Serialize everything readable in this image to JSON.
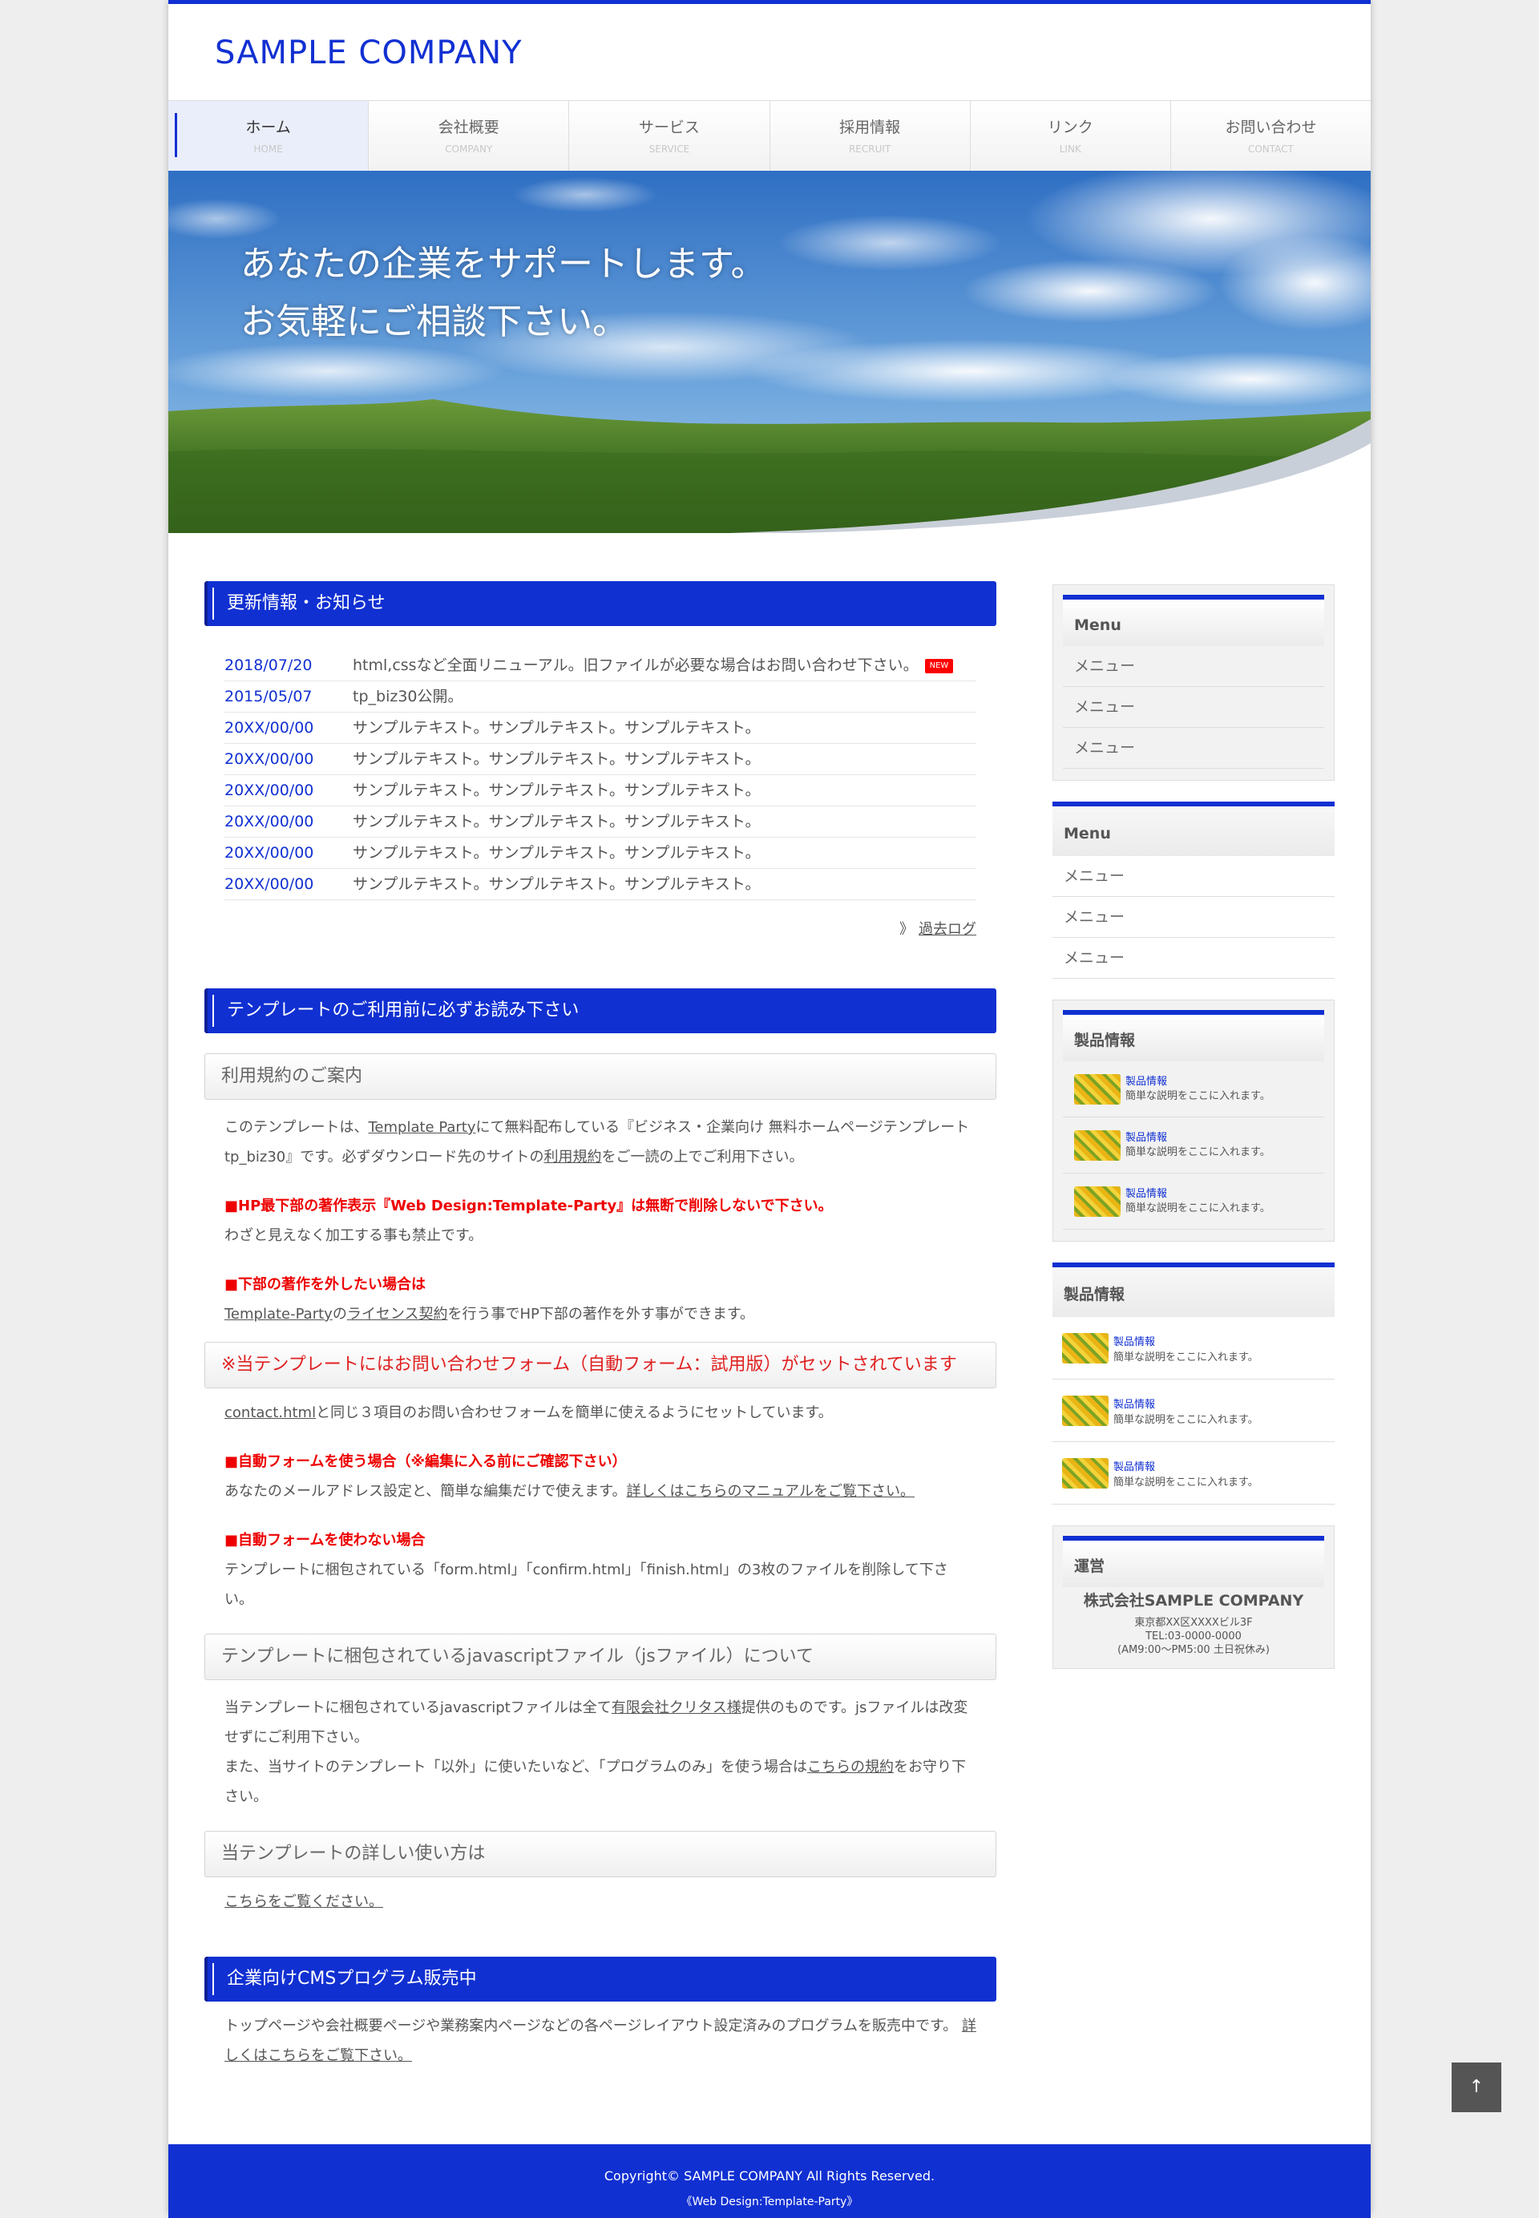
{
  "header": {
    "logo": "SAMPLE COMPANY"
  },
  "nav": [
    {
      "jp": "ホーム",
      "en": "HOME",
      "active": true
    },
    {
      "jp": "会社概要",
      "en": "COMPANY"
    },
    {
      "jp": "サービス",
      "en": "SERVICE"
    },
    {
      "jp": "採用情報",
      "en": "RECRUIT"
    },
    {
      "jp": "リンク",
      "en": "LINK"
    },
    {
      "jp": "お問い合わせ",
      "en": "CONTACT"
    }
  ],
  "hero": {
    "catch1": "あなたの企業をサポートします。",
    "catch2": "お気軽にご相談下さい。"
  },
  "news": {
    "title": "更新情報・お知らせ",
    "new_badge": "NEW",
    "items": [
      {
        "date": "2018/07/20",
        "text": "html,cssなど全面リニューアル。旧ファイルが必要な場合はお問い合わせ下さい。"
      },
      {
        "date": "2015/05/07",
        "text": "tp_biz30公開。"
      },
      {
        "date": "20XX/00/00",
        "text": "サンプルテキスト。サンプルテキスト。サンプルテキスト。"
      },
      {
        "date": "20XX/00/00",
        "text": "サンプルテキスト。サンプルテキスト。サンプルテキスト。"
      },
      {
        "date": "20XX/00/00",
        "text": "サンプルテキスト。サンプルテキスト。サンプルテキスト。"
      },
      {
        "date": "20XX/00/00",
        "text": "サンプルテキスト。サンプルテキスト。サンプルテキスト。"
      },
      {
        "date": "20XX/00/00",
        "text": "サンプルテキスト。サンプルテキスト。サンプルテキスト。"
      },
      {
        "date": "20XX/00/00",
        "text": "サンプルテキスト。サンプルテキスト。サンプルテキスト。"
      }
    ],
    "past_log_prefix": "》",
    "past_log": "過去ログ"
  },
  "template": {
    "title": "テンプレートのご利用前に必ずお読み下さい",
    "terms_heading": "利用規約のご案内",
    "terms_p1": "このテンプレートは、",
    "terms_link1": "Template Party",
    "terms_p2": "にて無料配布している『ビジネス・企業向け 無料ホームページテンプレート tp_biz30』です。必ずダウンロード先のサイトの",
    "terms_link2": "利用規約",
    "terms_p3": "をご一読の上でご利用下さい。",
    "red1": "■HP最下部の著作表示『Web Design:Template-Party』は無断で削除しないで下さい。",
    "red1_text": "わざと見えなく加工する事も禁止です。",
    "red2": "■下部の著作を外したい場合は",
    "red2_link1": "Template-Party",
    "red2_mid": "の",
    "red2_link2": "ライセンス契約",
    "red2_text": "を行う事でHP下部の著作を外す事ができます。",
    "form_heading": "※当テンプレートにはお問い合わせフォーム（自動フォーム：試用版）がセットされています",
    "form_link": "contact.html",
    "form_text": "と同じ３項目のお問い合わせフォームを簡単に使えるようにセットしています。",
    "red3": "■自動フォームを使う場合（※編集に入る前にご確認下さい）",
    "red3_text": "あなたのメールアドレス設定と、簡単な編集だけで使えます。",
    "red3_link": "詳しくはこちらのマニュアルをご覧下さい。",
    "red4": "■自動フォームを使わない場合",
    "red4_text": "テンプレートに梱包されている「form.html」「confirm.html」「finish.html」の3枚のファイルを削除して下さい。",
    "js_heading": "テンプレートに梱包されているjavascriptファイル（jsファイル）について",
    "js_p1": "当テンプレートに梱包されているjavascriptファイルは全て",
    "js_link1": "有限会社クリタス様",
    "js_p2": "提供のものです。jsファイルは改変せずにご利用下さい。",
    "js_p3": "また、当サイトのテンプレート「以外」に使いたいなど、「プログラムのみ」を使う場合は",
    "js_link2": "こちらの規約",
    "js_p4": "をお守り下さい。",
    "howto_heading": "当テンプレートの詳しい使い方は",
    "howto_link": "こちらをご覧ください。"
  },
  "cms": {
    "title": "企業向けCMSプログラム販売中",
    "text": "トップページや会社概要ページや業務案内ページなどの各ページレイアウト設定済みのプログラムを販売中です。",
    "link": "詳しくはこちらをご覧下さい。"
  },
  "sidebar": {
    "menu1": {
      "title": "Menu",
      "items": [
        "メニュー",
        "メニュー",
        "メニュー"
      ]
    },
    "menu2": {
      "title": "Menu",
      "items": [
        "メニュー",
        "メニュー",
        "メニュー"
      ]
    },
    "products1": {
      "title": "製品情報",
      "items": [
        {
          "name": "製品情報",
          "desc": "簡単な説明をここに入れます。"
        },
        {
          "name": "製品情報",
          "desc": "簡単な説明をここに入れます。"
        },
        {
          "name": "製品情報",
          "desc": "簡単な説明をここに入れます。"
        }
      ]
    },
    "products2": {
      "title": "製品情報",
      "items": [
        {
          "name": "製品情報",
          "desc": "簡単な説明をここに入れます。"
        },
        {
          "name": "製品情報",
          "desc": "簡単な説明をここに入れます。"
        },
        {
          "name": "製品情報",
          "desc": "簡単な説明をここに入れます。"
        }
      ]
    },
    "company": {
      "title": "運営",
      "name": "株式会社SAMPLE COMPANY",
      "address": "東京都XX区XXXXビル3F",
      "tel": "TEL:03-0000-0000",
      "hours": "(AM9:00〜PM5:00 土日祝休み)"
    }
  },
  "footer": {
    "copyright": "Copyright© SAMPLE COMPANY All Rights Reserved.",
    "credit": "《Web Design:Template-Party》"
  },
  "pagetop": "↑",
  "colors": {
    "accent": "#1130d2",
    "red": "#e00000"
  }
}
